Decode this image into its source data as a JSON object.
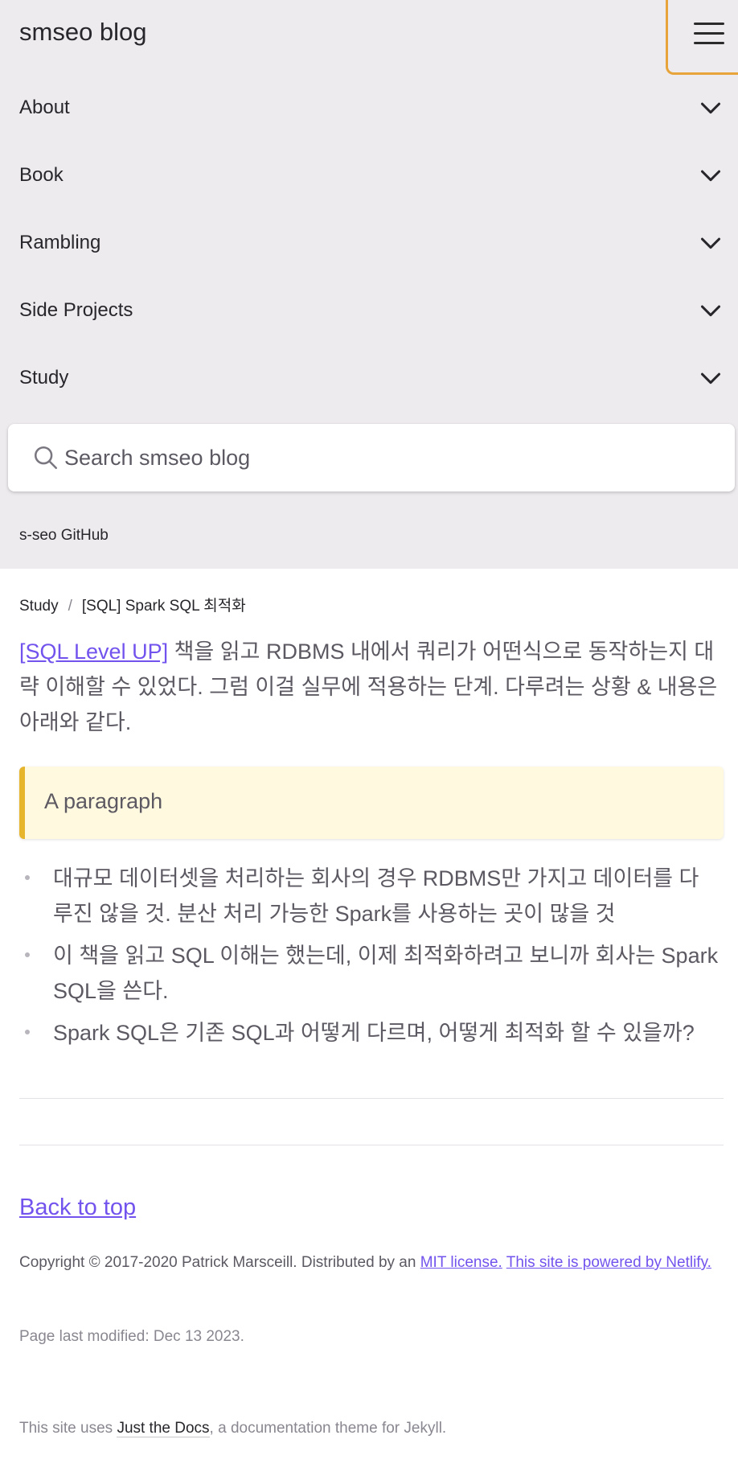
{
  "header": {
    "site_title": "smseo blog",
    "menu_label": "menu-icon"
  },
  "nav": {
    "items": [
      {
        "label": "About"
      },
      {
        "label": "Book"
      },
      {
        "label": "Rambling"
      },
      {
        "label": "Side Projects"
      },
      {
        "label": "Study"
      }
    ]
  },
  "search": {
    "placeholder": "Search smseo blog"
  },
  "aux": {
    "link": "s-seo GitHub"
  },
  "breadcrumb": {
    "parent": "Study",
    "separator": "/",
    "current": "[SQL] Spark SQL 최적화"
  },
  "content": {
    "intro_link": "[SQL Level UP]",
    "intro_text": " 책을 읽고 RDBMS 내에서 쿼리가 어떤식으로 동작하는지 대략 이해할 수 있었다. 그럼 이걸 실무에 적용하는 단계. 다루려는 상황 & 내용은 아래와 같다.",
    "note": "A paragraph",
    "bullets": [
      "대규모 데이터셋을 처리하는 회사의 경우 RDBMS만 가지고 데이터를 다루진 않을 것. 분산 처리 가능한 Spark를 사용하는 곳이 많을 것",
      "이 책을 읽고 SQL 이해는 했는데, 이제 최적화하려고 보니까 회사는 Spark SQL을 쓴다.",
      "Spark SQL은 기존 SQL과 어떻게 다르며, 어떻게 최적화 할 수 있을까?"
    ]
  },
  "footer": {
    "back_to_top": "Back to top",
    "copyright_text": "Copyright © 2017-2020 Patrick Marsceill. Distributed by an ",
    "mit_link": "MIT license.",
    "netlify_link": "This site is powered by Netlify.",
    "last_modified": "Page last modified: Dec 13 2023.",
    "theme_prefix": "This site uses ",
    "theme_link": "Just the Docs",
    "theme_suffix": ", a documentation theme for Jekyll."
  },
  "colors": {
    "sidebar_bg": "#eeebee",
    "link": "#7253ed",
    "note_bg": "#fff9e0",
    "note_border": "#e7b52c",
    "menu_border": "#e6a43a"
  }
}
